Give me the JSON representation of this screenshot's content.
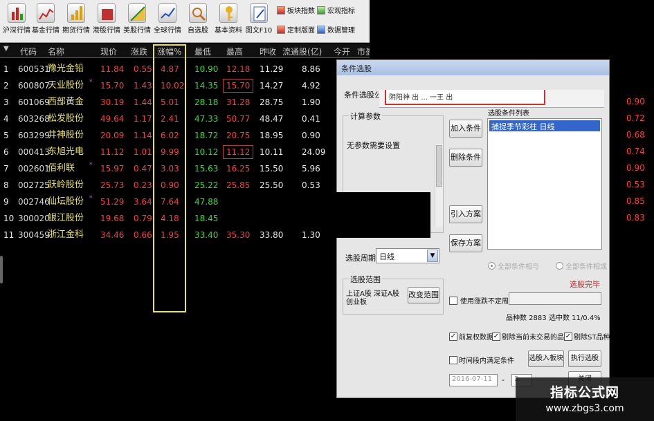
{
  "toolbar": {
    "buttons": [
      {
        "label": "沪深行情"
      },
      {
        "label": "基金行情"
      },
      {
        "label": "期货行情"
      },
      {
        "label": "港股行情"
      },
      {
        "label": "美股行情"
      },
      {
        "label": "全球行情"
      },
      {
        "label": "自选股"
      },
      {
        "label": "基本资料"
      },
      {
        "label": "图文F10"
      }
    ],
    "small_buttons": [
      {
        "label": "板块指数"
      },
      {
        "label": "宏观指标"
      },
      {
        "label": "定制版面"
      },
      {
        "label": "数据管理"
      }
    ]
  },
  "table": {
    "headers": {
      "code": "代码",
      "name": "名称",
      "price": "现价",
      "change": "涨跌",
      "pct": "涨幅%",
      "low": "最低",
      "high": "最高",
      "prev": "昨收",
      "float": "流通股(亿)",
      "open": "今开",
      "mcap": "市盈"
    },
    "rows": [
      {
        "idx": "1",
        "code": "600531",
        "name": "豫光金铅",
        "price": "11.84",
        "change": "0.55",
        "pct": "4.87",
        "low": "10.90",
        "high": "12.18",
        "prev": "11.29",
        "float": "8.86",
        "star": ""
      },
      {
        "idx": "2",
        "code": "600807",
        "name": "天业股份",
        "price": "15.70",
        "change": "1.43",
        "pct": "10.02",
        "low": "14.35",
        "high": "15.70",
        "prev": "14.27",
        "float": "4.92",
        "star": "*"
      },
      {
        "idx": "3",
        "code": "601069",
        "name": "西部黄金",
        "price": "30.19",
        "change": "1.44",
        "pct": "5.01",
        "low": "28.18",
        "high": "31.28",
        "prev": "28.75",
        "float": "1.90",
        "star": ""
      },
      {
        "idx": "4",
        "code": "603268",
        "name": "松发股份",
        "price": "49.64",
        "change": "1.17",
        "pct": "2.41",
        "low": "47.33",
        "high": "50.77",
        "prev": "48.47",
        "float": "0.41",
        "star": ""
      },
      {
        "idx": "5",
        "code": "603299",
        "name": "井神股份",
        "price": "20.09",
        "change": "1.14",
        "pct": "6.02",
        "low": "18.72",
        "high": "20.75",
        "prev": "18.95",
        "float": "0.90",
        "star": ""
      },
      {
        "idx": "6",
        "code": "000413",
        "name": "东旭光电",
        "price": "11.12",
        "change": "1.01",
        "pct": "9.99",
        "low": "10.12",
        "high": "11.12",
        "prev": "10.11",
        "float": "24.09",
        "star": ""
      },
      {
        "idx": "7",
        "code": "002601",
        "name": "佰利联",
        "price": "15.97",
        "change": "0.47",
        "pct": "3.03",
        "low": "15.63",
        "high": "16.25",
        "prev": "15.50",
        "float": "5.96",
        "star": "*"
      },
      {
        "idx": "8",
        "code": "002725",
        "name": "跃岭股份",
        "price": "25.73",
        "change": "0.23",
        "pct": "0.90",
        "low": "25.22",
        "high": "25.85",
        "prev": "25.50",
        "float": "0.53",
        "star": ""
      },
      {
        "idx": "9",
        "code": "002746",
        "name": "仙坛股份",
        "price": "51.29",
        "change": "3.64",
        "pct": "7.64",
        "low": "47.88",
        "high": "",
        "prev": "",
        "float": "",
        "star": "*"
      },
      {
        "idx": "10",
        "code": "300020",
        "name": "银江股份",
        "price": "19.68",
        "change": "0.79",
        "pct": "4.18",
        "low": "18.45",
        "high": "",
        "prev": "",
        "float": "",
        "star": ""
      },
      {
        "idx": "11",
        "code": "300459",
        "name": "浙江金科",
        "price": "34.46",
        "change": "0.66",
        "pct": "1.95",
        "low": "33.40",
        "high": "35.30",
        "prev": "33.80",
        "float": "1.30",
        "star": ""
      }
    ],
    "right_edge_values": [
      "0.90",
      "0.72",
      "0.68",
      "0.74",
      "0.90",
      "0.53",
      "0.85",
      "0.83"
    ]
  },
  "dialog": {
    "title": "条件选股",
    "formula_label": "条件选股公",
    "formula_value": "阴阳神 出 ... 一王 出",
    "calc_params_label": "计算参数",
    "no_params_text": "无参数需要设置",
    "add_condition": "加入条件",
    "delete_condition": "删除条件",
    "import_plan": "引入方案",
    "save_plan": "保存方案",
    "condition_list_label": "选股条件列表",
    "condition_list_item": "捕捉季节彩柱  日线",
    "period_label": "选股周期",
    "period_value": "日线",
    "all_and": "全部条件相与",
    "all_or": "全部条件相或",
    "status": "选股完毕",
    "range_label": "选股范围",
    "range_text": "上证A股 深证A股 创业板",
    "change_range": "改变范围",
    "use_price_limit": "使用涨跌不定周期",
    "stock_count_label": "品种数 2883",
    "selected_count_label": "选中数 11/0.4%",
    "pre_adjust": "前复权数据",
    "exclude_suspended": "剔除当前未交易的品种",
    "exclude_st": "剔除ST品种",
    "time_condition": "时间段内满足条件",
    "add_to_block": "选股入板块",
    "execute": "执行选股",
    "date_from": "2016-07-11",
    "date_sep": "-",
    "date_to": "2",
    "close_button": "关闭"
  },
  "watermark": {
    "line1": "指标公式网",
    "line2": "www.zbgs3.com"
  }
}
